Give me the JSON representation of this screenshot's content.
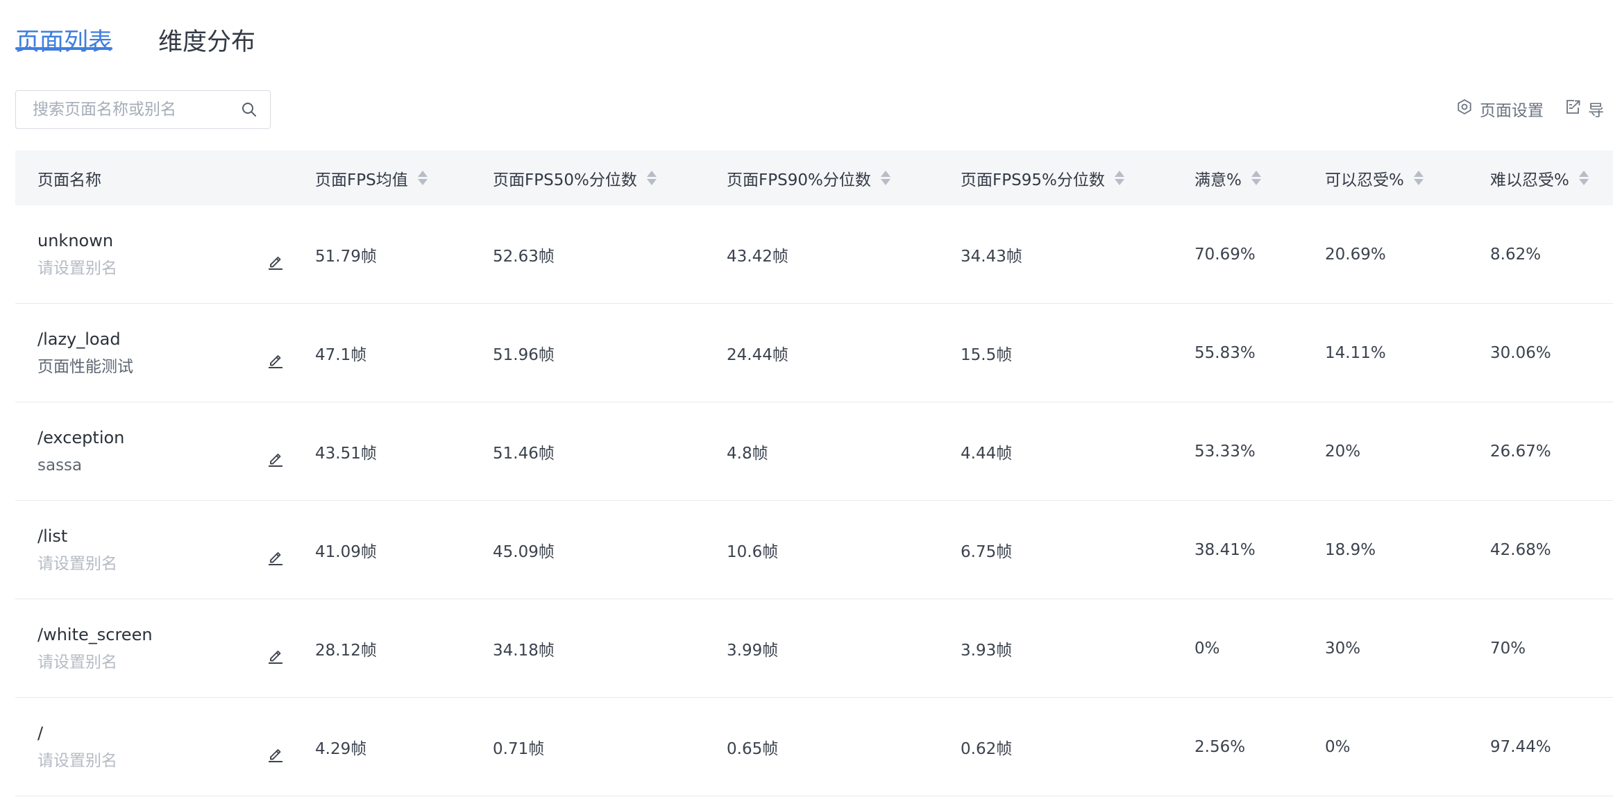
{
  "tabs": [
    {
      "label": "页面列表",
      "active": true
    },
    {
      "label": "维度分布",
      "active": false
    }
  ],
  "search": {
    "placeholder": "搜索页面名称或别名",
    "value": "",
    "icon": "search-icon"
  },
  "actions": [
    {
      "label": "页面设置",
      "icon": "settings-icon"
    },
    {
      "label": "导",
      "icon": "export-icon"
    }
  ],
  "table": {
    "columns": [
      "页面名称",
      "页面FPS均值",
      "页面FPS50%分位数",
      "页面FPS90%分位数",
      "页面FPS95%分位数",
      "满意%",
      "可以忍受%",
      "难以忍受%"
    ],
    "rows": [
      {
        "name": "unknown",
        "alias": "请设置别名",
        "alias_set": false,
        "cells": [
          "51.79帧",
          "52.63帧",
          "43.42帧",
          "34.43帧",
          "70.69%",
          "20.69%",
          "8.62%"
        ]
      },
      {
        "name": "/lazy_load",
        "alias": "页面性能测试",
        "alias_set": true,
        "cells": [
          "47.1帧",
          "51.96帧",
          "24.44帧",
          "15.5帧",
          "55.83%",
          "14.11%",
          "30.06%"
        ]
      },
      {
        "name": "/exception",
        "alias": "sassa",
        "alias_set": true,
        "cells": [
          "43.51帧",
          "51.46帧",
          "4.8帧",
          "4.44帧",
          "53.33%",
          "20%",
          "26.67%"
        ]
      },
      {
        "name": "/list",
        "alias": "请设置别名",
        "alias_set": false,
        "cells": [
          "41.09帧",
          "45.09帧",
          "10.6帧",
          "6.75帧",
          "38.41%",
          "18.9%",
          "42.68%"
        ]
      },
      {
        "name": "/white_screen",
        "alias": "请设置别名",
        "alias_set": false,
        "cells": [
          "28.12帧",
          "34.18帧",
          "3.99帧",
          "3.93帧",
          "0%",
          "30%",
          "70%"
        ]
      },
      {
        "name": "/",
        "alias": "请设置别名",
        "alias_set": false,
        "cells": [
          "4.29帧",
          "0.71帧",
          "0.65帧",
          "0.62帧",
          "2.56%",
          "0%",
          "97.44%"
        ]
      }
    ]
  },
  "colors": {
    "accent": "#3f7fe0",
    "header_bg": "#f4f6f8",
    "border": "#e6e9ee",
    "placeholder_text": "#b5bbc4"
  }
}
